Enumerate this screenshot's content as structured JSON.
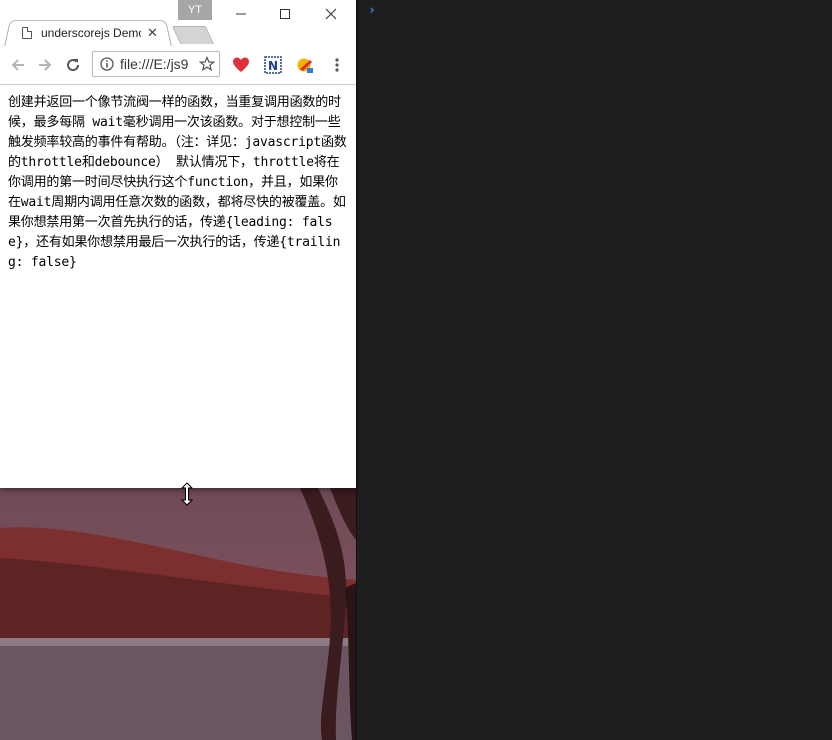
{
  "window": {
    "profile_badge": "YT",
    "tab": {
      "title": "underscorejs Demo",
      "close_glyph": "✕"
    }
  },
  "toolbar": {
    "url": "file:///E:/js9",
    "icons": [
      "back-icon",
      "forward-icon",
      "reload-icon",
      "info-icon",
      "star-icon",
      "heart-extension-icon",
      "n-extension-icon",
      "paint-extension-icon",
      "menu-icon"
    ]
  },
  "page": {
    "text": "创建并返回一个像节流阀一样的函数，当重复调用函数的时候，最多每隔 wait毫秒调用一次该函数。对于想控制一些触发频率较高的事件有帮助。（注：详见：javascript函数的throttle和debounce） 默认情况下，throttle将在你调用的第一时间尽快执行这个function，并且，如果你在wait周期内调用任意次数的函数，都将尽快的被覆盖。如果你想禁用第一次首先执行的话，传递{leading: false}，还有如果你想禁用最后一次执行的话，传递{trailing: false}"
  },
  "terminal": {
    "prompt": "›"
  },
  "colors": {
    "terminal_bg": "#1e1e1e",
    "prompt": "#3b8eea",
    "heart": "#e0303a"
  }
}
